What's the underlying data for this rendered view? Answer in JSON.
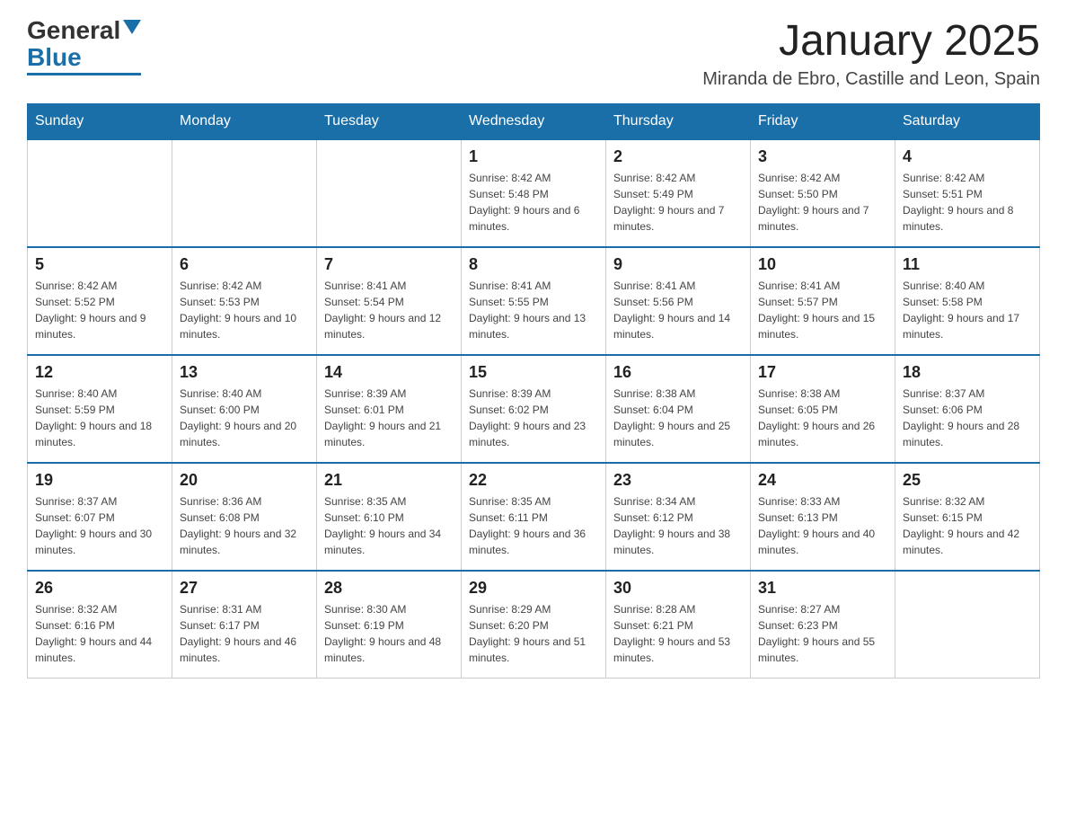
{
  "header": {
    "logo_general": "General",
    "logo_blue": "Blue",
    "month_title": "January 2025",
    "location": "Miranda de Ebro, Castille and Leon, Spain"
  },
  "days_of_week": [
    "Sunday",
    "Monday",
    "Tuesday",
    "Wednesday",
    "Thursday",
    "Friday",
    "Saturday"
  ],
  "weeks": [
    [
      {
        "day": "",
        "info": ""
      },
      {
        "day": "",
        "info": ""
      },
      {
        "day": "",
        "info": ""
      },
      {
        "day": "1",
        "info": "Sunrise: 8:42 AM\nSunset: 5:48 PM\nDaylight: 9 hours and 6 minutes."
      },
      {
        "day": "2",
        "info": "Sunrise: 8:42 AM\nSunset: 5:49 PM\nDaylight: 9 hours and 7 minutes."
      },
      {
        "day": "3",
        "info": "Sunrise: 8:42 AM\nSunset: 5:50 PM\nDaylight: 9 hours and 7 minutes."
      },
      {
        "day": "4",
        "info": "Sunrise: 8:42 AM\nSunset: 5:51 PM\nDaylight: 9 hours and 8 minutes."
      }
    ],
    [
      {
        "day": "5",
        "info": "Sunrise: 8:42 AM\nSunset: 5:52 PM\nDaylight: 9 hours and 9 minutes."
      },
      {
        "day": "6",
        "info": "Sunrise: 8:42 AM\nSunset: 5:53 PM\nDaylight: 9 hours and 10 minutes."
      },
      {
        "day": "7",
        "info": "Sunrise: 8:41 AM\nSunset: 5:54 PM\nDaylight: 9 hours and 12 minutes."
      },
      {
        "day": "8",
        "info": "Sunrise: 8:41 AM\nSunset: 5:55 PM\nDaylight: 9 hours and 13 minutes."
      },
      {
        "day": "9",
        "info": "Sunrise: 8:41 AM\nSunset: 5:56 PM\nDaylight: 9 hours and 14 minutes."
      },
      {
        "day": "10",
        "info": "Sunrise: 8:41 AM\nSunset: 5:57 PM\nDaylight: 9 hours and 15 minutes."
      },
      {
        "day": "11",
        "info": "Sunrise: 8:40 AM\nSunset: 5:58 PM\nDaylight: 9 hours and 17 minutes."
      }
    ],
    [
      {
        "day": "12",
        "info": "Sunrise: 8:40 AM\nSunset: 5:59 PM\nDaylight: 9 hours and 18 minutes."
      },
      {
        "day": "13",
        "info": "Sunrise: 8:40 AM\nSunset: 6:00 PM\nDaylight: 9 hours and 20 minutes."
      },
      {
        "day": "14",
        "info": "Sunrise: 8:39 AM\nSunset: 6:01 PM\nDaylight: 9 hours and 21 minutes."
      },
      {
        "day": "15",
        "info": "Sunrise: 8:39 AM\nSunset: 6:02 PM\nDaylight: 9 hours and 23 minutes."
      },
      {
        "day": "16",
        "info": "Sunrise: 8:38 AM\nSunset: 6:04 PM\nDaylight: 9 hours and 25 minutes."
      },
      {
        "day": "17",
        "info": "Sunrise: 8:38 AM\nSunset: 6:05 PM\nDaylight: 9 hours and 26 minutes."
      },
      {
        "day": "18",
        "info": "Sunrise: 8:37 AM\nSunset: 6:06 PM\nDaylight: 9 hours and 28 minutes."
      }
    ],
    [
      {
        "day": "19",
        "info": "Sunrise: 8:37 AM\nSunset: 6:07 PM\nDaylight: 9 hours and 30 minutes."
      },
      {
        "day": "20",
        "info": "Sunrise: 8:36 AM\nSunset: 6:08 PM\nDaylight: 9 hours and 32 minutes."
      },
      {
        "day": "21",
        "info": "Sunrise: 8:35 AM\nSunset: 6:10 PM\nDaylight: 9 hours and 34 minutes."
      },
      {
        "day": "22",
        "info": "Sunrise: 8:35 AM\nSunset: 6:11 PM\nDaylight: 9 hours and 36 minutes."
      },
      {
        "day": "23",
        "info": "Sunrise: 8:34 AM\nSunset: 6:12 PM\nDaylight: 9 hours and 38 minutes."
      },
      {
        "day": "24",
        "info": "Sunrise: 8:33 AM\nSunset: 6:13 PM\nDaylight: 9 hours and 40 minutes."
      },
      {
        "day": "25",
        "info": "Sunrise: 8:32 AM\nSunset: 6:15 PM\nDaylight: 9 hours and 42 minutes."
      }
    ],
    [
      {
        "day": "26",
        "info": "Sunrise: 8:32 AM\nSunset: 6:16 PM\nDaylight: 9 hours and 44 minutes."
      },
      {
        "day": "27",
        "info": "Sunrise: 8:31 AM\nSunset: 6:17 PM\nDaylight: 9 hours and 46 minutes."
      },
      {
        "day": "28",
        "info": "Sunrise: 8:30 AM\nSunset: 6:19 PM\nDaylight: 9 hours and 48 minutes."
      },
      {
        "day": "29",
        "info": "Sunrise: 8:29 AM\nSunset: 6:20 PM\nDaylight: 9 hours and 51 minutes."
      },
      {
        "day": "30",
        "info": "Sunrise: 8:28 AM\nSunset: 6:21 PM\nDaylight: 9 hours and 53 minutes."
      },
      {
        "day": "31",
        "info": "Sunrise: 8:27 AM\nSunset: 6:23 PM\nDaylight: 9 hours and 55 minutes."
      },
      {
        "day": "",
        "info": ""
      }
    ]
  ]
}
